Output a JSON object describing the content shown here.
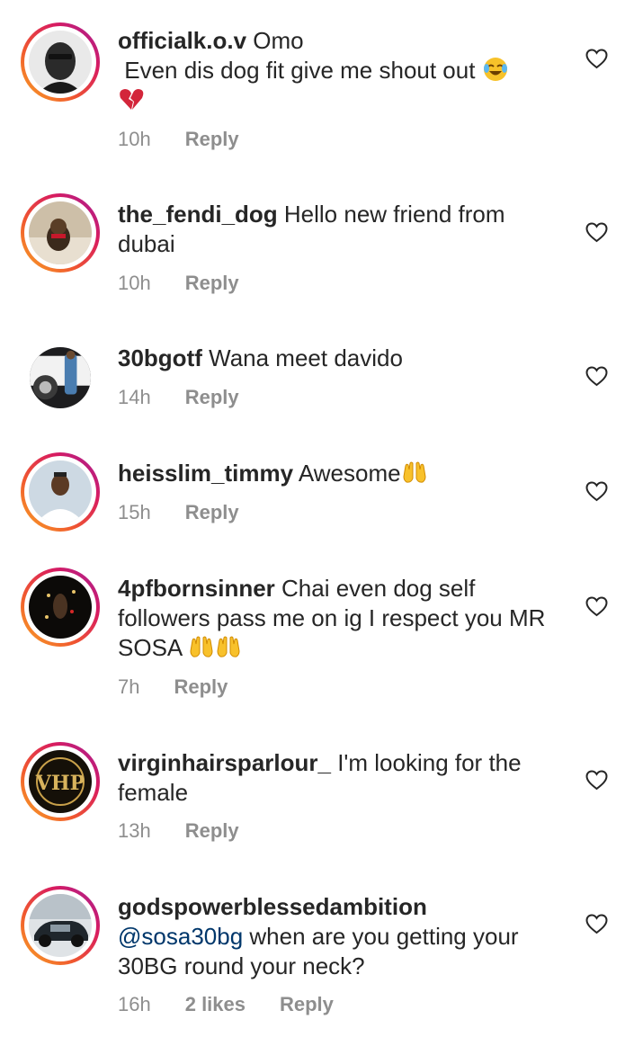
{
  "colors": {
    "text": "#262626",
    "meta": "#8e8e8e",
    "mention": "#00376b",
    "ring_gradient": [
      "#f9a825",
      "#f0582f",
      "#d81b60",
      "#a0229c"
    ]
  },
  "comments": [
    {
      "username": "officialk.o.v",
      "text_before": " Omo\n Even dis dog fit give me shout out ",
      "emojis": [
        "face-with-tears-of-joy",
        "broken-heart"
      ],
      "time": "10h",
      "reply": "Reply",
      "story_ring": true
    },
    {
      "username": "the_fendi_dog",
      "text": " Hello new friend from dubai",
      "time": "10h",
      "reply": "Reply",
      "story_ring": true
    },
    {
      "username": "30bgotf",
      "text": " Wana meet davido",
      "time": "14h",
      "reply": "Reply",
      "story_ring": false
    },
    {
      "username": "heisslim_timmy",
      "text": " Awesome",
      "emojis": [
        "raising-hands"
      ],
      "time": "15h",
      "reply": "Reply",
      "story_ring": true
    },
    {
      "username": "4pfbornsinner",
      "text": " Chai even dog self followers pass me on ig I respect you MR SOSA ",
      "emojis": [
        "raising-hands",
        "raising-hands"
      ],
      "time": "7h",
      "reply": "Reply",
      "story_ring": true
    },
    {
      "username": "virginhairsparlour_",
      "text": " I'm looking for the female",
      "time": "13h",
      "reply": "Reply",
      "story_ring": true
    },
    {
      "username": "godspowerblessedambition",
      "mention": "@sosa30bg",
      "text": " when are you getting your 30BG round your neck?",
      "time": "16h",
      "likes": "2 likes",
      "reply": "Reply",
      "story_ring": true
    }
  ]
}
